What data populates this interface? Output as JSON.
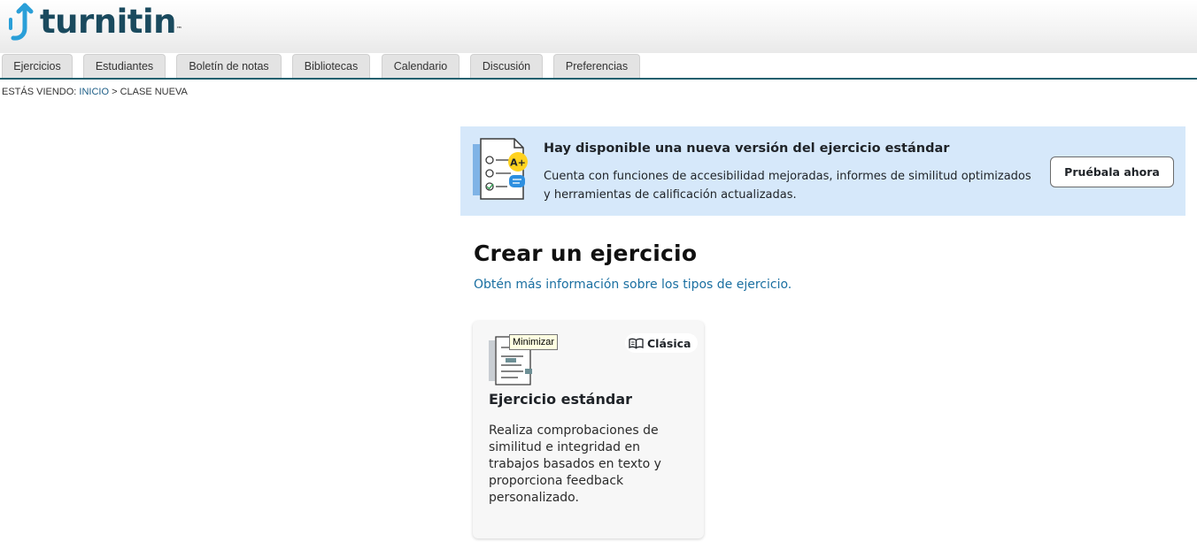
{
  "header": {
    "logo_text": "turnitin",
    "logo_tm": "™"
  },
  "tabs": [
    {
      "label": "Ejercicios"
    },
    {
      "label": "Estudiantes"
    },
    {
      "label": "Boletín de notas"
    },
    {
      "label": "Bibliotecas"
    },
    {
      "label": "Calendario"
    },
    {
      "label": "Discusión"
    },
    {
      "label": "Preferencias"
    }
  ],
  "breadcrumb": {
    "prefix": "ESTÁS VIENDO:",
    "home": "INICIO",
    "separator": ">",
    "current": "CLASE NUEVA"
  },
  "banner": {
    "title": "Hay disponible una nueva versión del ejercicio estándar",
    "description": "Cuenta con funciones de accesibilidad mejoradas, informes de similitud optimizados y herramientas de calificación actualizadas.",
    "button_label": "Pruébala ahora",
    "grade_badge": "A+"
  },
  "main": {
    "title": "Crear un ejercicio",
    "info_link": "Obtén más información sobre los tipos de ejercicio."
  },
  "card": {
    "tooltip": "Minimizar",
    "badge_label": "Clásica",
    "title": "Ejercicio estándar",
    "description": "Realiza comprobaciones de similitud e integridad en trabajos basados en texto y proporciona feedback personalizado."
  },
  "colors": {
    "accent": "#22606e",
    "link": "#1a6fa1",
    "banner_bg": "#d6e8fa",
    "logo_blue": "#2a9fd8"
  }
}
